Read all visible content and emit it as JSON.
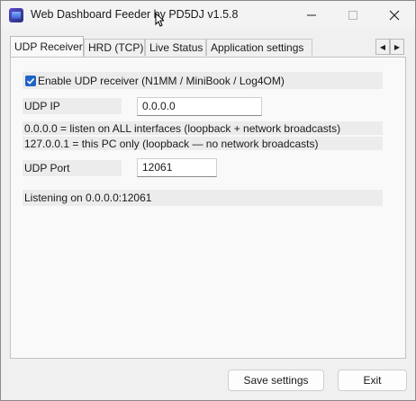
{
  "window": {
    "title": "Web Dashboard Feeder by PD5DJ  v1.5.8",
    "controls": {
      "minimize": "—",
      "maximize": "☐",
      "close": "✕"
    }
  },
  "tabs": [
    {
      "label": "UDP Receiver",
      "active": true
    },
    {
      "label": "HRD (TCP)",
      "active": false
    },
    {
      "label": "Live Status",
      "active": false
    },
    {
      "label": "Application settings",
      "active": false
    }
  ],
  "tab_scroll": {
    "left": "◀",
    "right": "▶"
  },
  "udp": {
    "enable_label": "Enable UDP receiver (N1MM / MiniBook / Log4OM)",
    "enable_checked": true,
    "ip_label": "UDP IP",
    "ip_value": "0.0.0.0",
    "info_line_1": "0.0.0.0  = listen on ALL interfaces (loopback + network broadcasts)",
    "info_line_2": "127.0.0.1 = this PC only (loopback — no network broadcasts)",
    "port_label": "UDP Port",
    "port_value": "12061",
    "status": "Listening on 0.0.0.0:12061"
  },
  "footer": {
    "save_label": "Save settings",
    "exit_label": "Exit"
  }
}
